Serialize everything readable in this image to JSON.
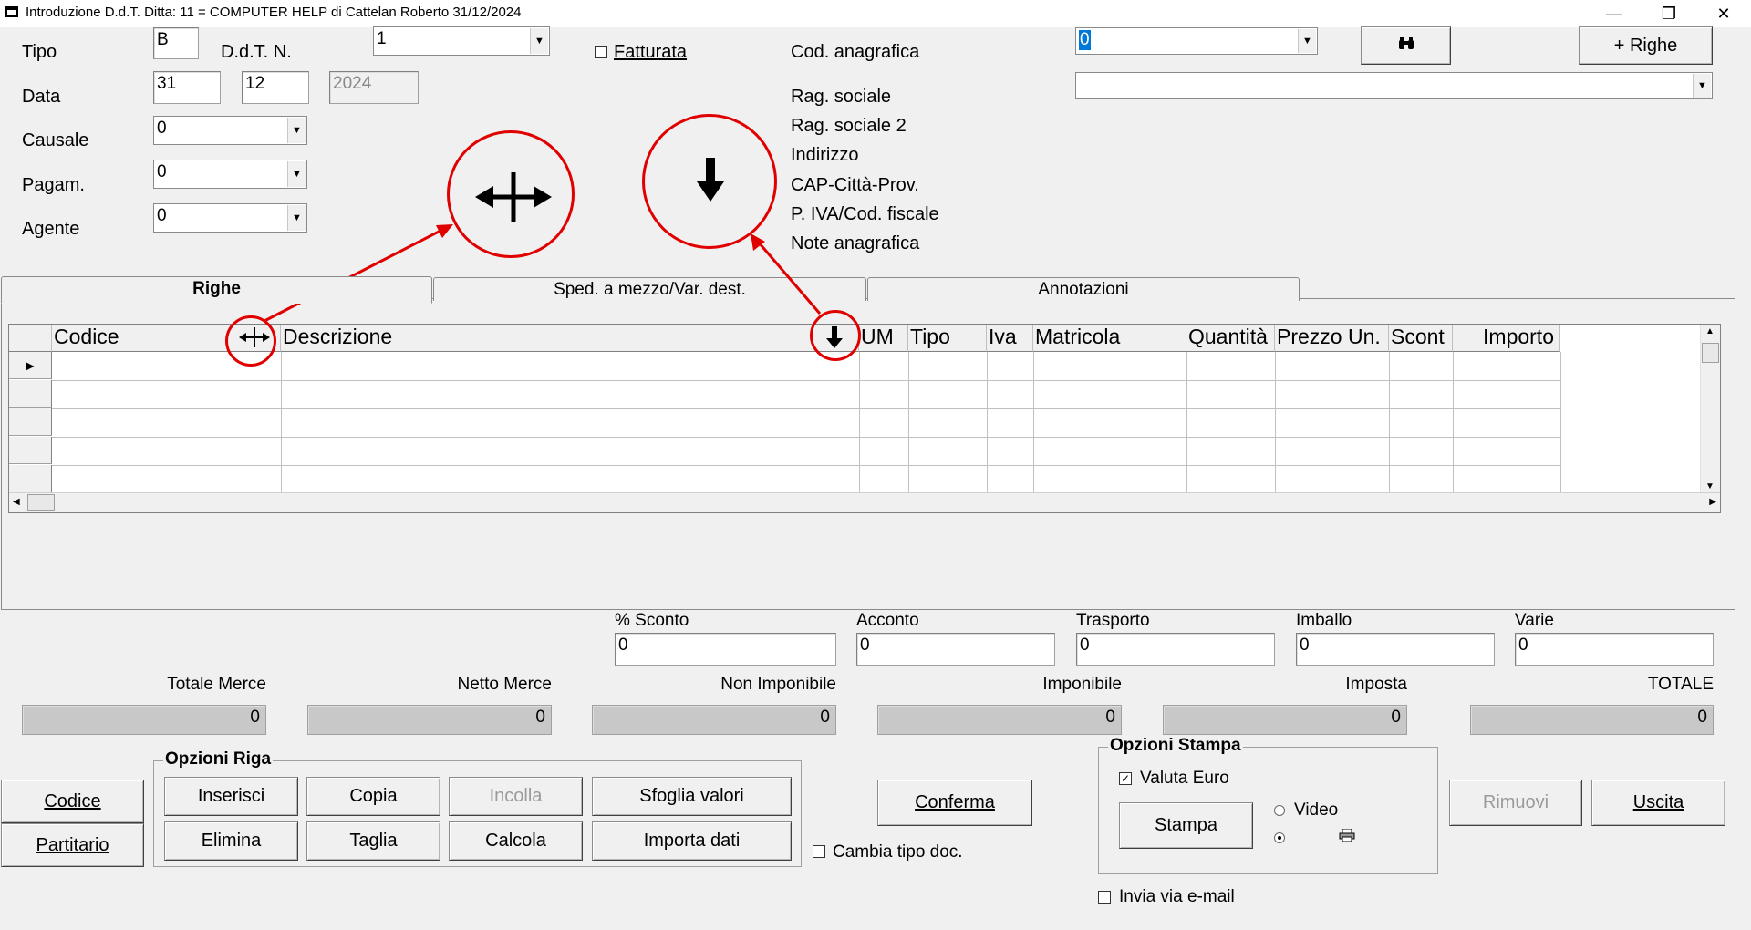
{
  "window": {
    "title": "Introduzione D.d.T.  Ditta: 11 = COMPUTER HELP di Cattelan Roberto  31/12/2024",
    "minimize": "—",
    "maximize": "❐",
    "close": "✕"
  },
  "header": {
    "tipo_label": "Tipo",
    "tipo_value": "B",
    "ddt_label": "D.d.T. N.",
    "ddt_value": "1",
    "fatturata_label": "Fatturata",
    "data_label": "Data",
    "day": "31",
    "month": "12",
    "year": "2024",
    "causale_label": "Causale",
    "causale_value": "0",
    "pagam_label": "Pagam.",
    "pagam_value": "0",
    "agente_label": "Agente",
    "agente_value": "0",
    "cod_anagrafica_label": "Cod. anagrafica",
    "cod_anagrafica_value": "0",
    "search_icon": "binoculars-icon",
    "righe_button": "+ Righe",
    "anagrafica_labels": [
      "Rag. sociale",
      "Rag. sociale 2",
      "Indirizzo",
      "CAP-Città-Prov.",
      "P. IVA/Cod. fiscale",
      "Note anagrafica"
    ]
  },
  "tabs": [
    "Righe",
    "Sped. a mezzo/Var. dest.",
    "Annotazioni"
  ],
  "grid": {
    "columns": [
      "Codice",
      "Descrizione",
      "UM",
      "Tipo",
      "Iva",
      "Matricola",
      "Quantità",
      "Prezzo Un.",
      "Scont",
      "Importo"
    ],
    "row_count": 5
  },
  "discounts": {
    "labels": [
      "% Sconto",
      "Acconto",
      "Trasporto",
      "Imballo",
      "Varie"
    ],
    "values": [
      "0",
      "0",
      "0",
      "0",
      "0"
    ]
  },
  "totals": {
    "labels": [
      "Totale Merce",
      "Netto Merce",
      "Non Imponibile",
      "Imponibile",
      "Imposta",
      "TOTALE"
    ],
    "values": [
      "0",
      "0",
      "0",
      "0",
      "0",
      "0"
    ]
  },
  "left_buttons": {
    "codice": "Codice",
    "partitario": "Partitario"
  },
  "opzioni_riga": {
    "title": "Opzioni Riga",
    "inserisci": "Inserisci",
    "copia": "Copia",
    "incolla": "Incolla",
    "sfoglia": "Sfoglia valori",
    "elimina": "Elimina",
    "taglia": "Taglia",
    "calcola": "Calcola",
    "importa": "Importa dati"
  },
  "conferma": "Conferma",
  "cambia_tipo": "Cambia tipo doc.",
  "opzioni_stampa": {
    "title": "Opzioni Stampa",
    "valuta_euro": "Valuta Euro",
    "stampa": "Stampa",
    "video": "Video",
    "printer_icon": "printer-icon"
  },
  "invia_email": "Invia via e-mail",
  "rimuovi": "Rimuovi",
  "uscita": "Uscita",
  "annotation": {
    "color": "#e00000",
    "cursor_resize": "resize-horizontal-cursor-icon",
    "cursor_down": "down-arrow-cursor-icon"
  }
}
